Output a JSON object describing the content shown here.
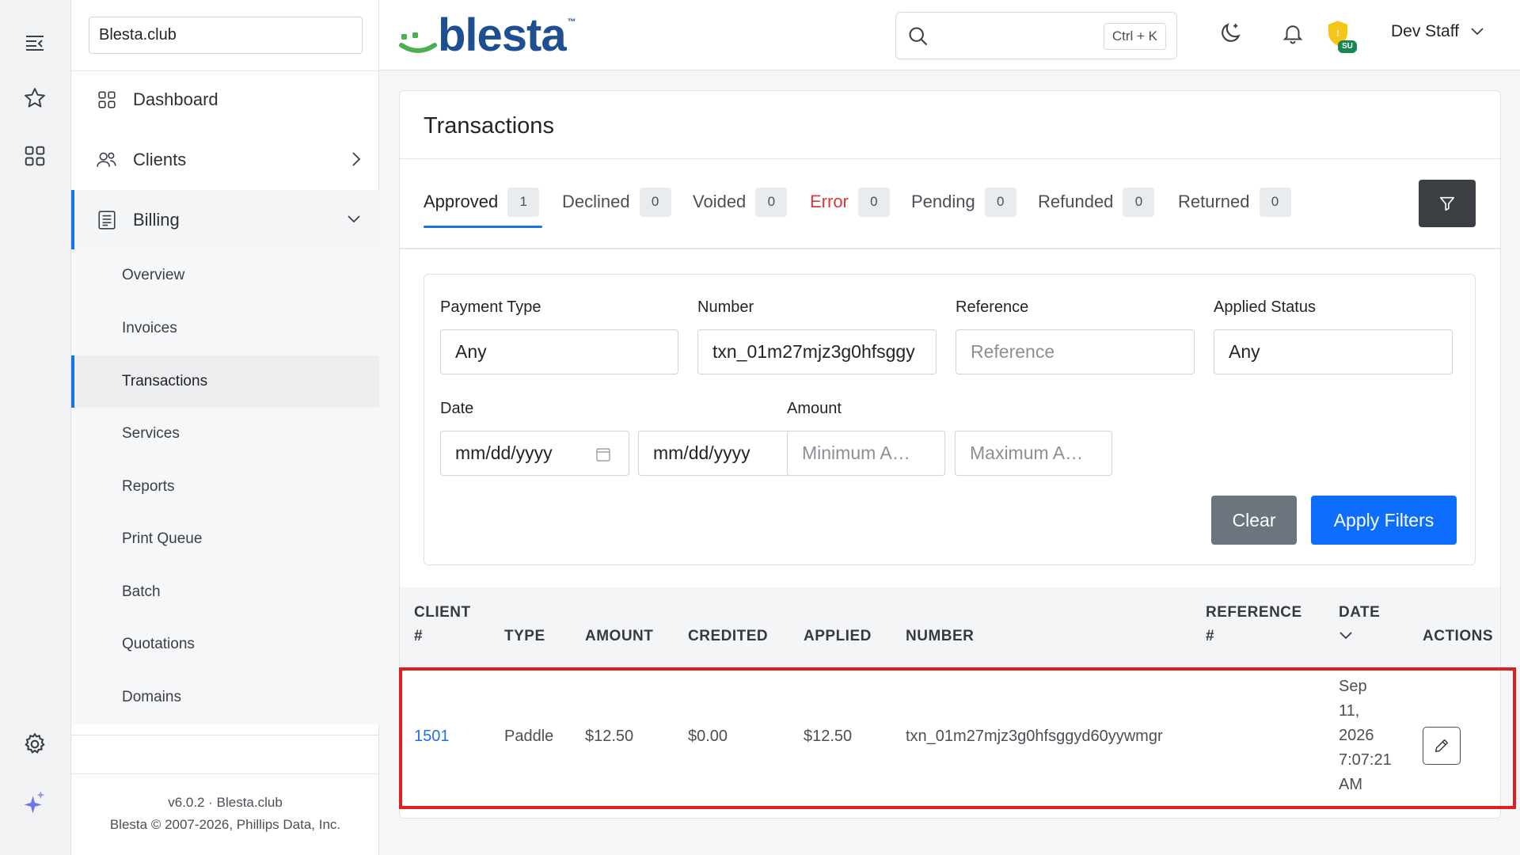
{
  "header": {
    "logo_text": "blesta",
    "logo_tm": "™",
    "search_placeholder": "",
    "search_shortcut": "Ctrl + K",
    "su_badge": "SU",
    "user_name": "Dev Staff"
  },
  "sidebar": {
    "company": "Blesta.club",
    "nav": [
      {
        "label": "Dashboard",
        "icon": "grid-icon"
      },
      {
        "label": "Clients",
        "icon": "users-icon"
      },
      {
        "label": "Billing",
        "icon": "receipt-icon"
      }
    ],
    "billing_items": [
      {
        "label": "Overview"
      },
      {
        "label": "Invoices"
      },
      {
        "label": "Transactions"
      },
      {
        "label": "Services"
      },
      {
        "label": "Reports"
      },
      {
        "label": "Print Queue"
      },
      {
        "label": "Batch"
      },
      {
        "label": "Quotations"
      },
      {
        "label": "Domains"
      }
    ],
    "footer_version": "v6.0.2 · Blesta.club",
    "footer_copyright": "Blesta © 2007-2026, Phillips Data, Inc."
  },
  "page": {
    "title": "Transactions",
    "tabs": [
      {
        "label": "Approved",
        "count": "1"
      },
      {
        "label": "Declined",
        "count": "0"
      },
      {
        "label": "Voided",
        "count": "0"
      },
      {
        "label": "Error",
        "count": "0"
      },
      {
        "label": "Pending",
        "count": "0"
      },
      {
        "label": "Refunded",
        "count": "0"
      },
      {
        "label": "Returned",
        "count": "0"
      }
    ],
    "filters": {
      "payment_type_label": "Payment Type",
      "payment_type_value": "Any",
      "number_label": "Number",
      "number_value": "txn_01m27mjz3g0hfsggy",
      "reference_label": "Reference",
      "reference_placeholder": "Reference",
      "applied_status_label": "Applied Status",
      "applied_status_value": "Any",
      "date_label": "Date",
      "date_from_placeholder": "mm/dd/yyyy",
      "date_to_placeholder": "mm/dd/yyyy",
      "amount_label": "Amount",
      "amount_min_placeholder": "Minimum A…",
      "amount_max_placeholder": "Maximum A…",
      "clear_label": "Clear",
      "apply_label": "Apply Filters"
    },
    "table": {
      "headers": {
        "client_1": "CLIENT",
        "client_2": "#",
        "type": "TYPE",
        "amount": "AMOUNT",
        "credited": "CREDITED",
        "applied": "APPLIED",
        "number": "NUMBER",
        "reference_1": "REFERENCE",
        "reference_2": "#",
        "date": "DATE",
        "actions": "ACTIONS"
      },
      "rows": [
        {
          "client": "1501",
          "type": "Paddle",
          "amount": "$12.50",
          "credited": "$0.00",
          "applied": "$12.50",
          "number": "txn_01m27mjz3g0hfsggyd60yywmgr",
          "reference": "",
          "date_1": "Sep",
          "date_2": "11,",
          "date_3": "2026",
          "date_4": "7:07:21",
          "date_5": "AM"
        }
      ]
    }
  },
  "colors": {
    "accent": "#1a73e8",
    "error": "#d63939",
    "apply_button": "#0d6efd",
    "clear_button": "#6c757d",
    "highlight": "#e02020"
  }
}
